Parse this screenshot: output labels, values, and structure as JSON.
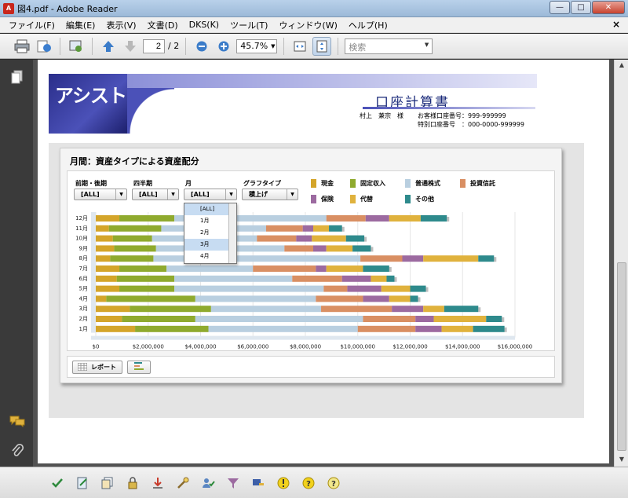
{
  "window": {
    "title": "図4.pdf - Adobe Reader"
  },
  "menu": {
    "items": [
      "ファイル(F)",
      "編集(E)",
      "表示(V)",
      "文書(D)",
      "DKS(K)",
      "ツール(T)",
      "ウィンドウ(W)",
      "ヘルプ(H)"
    ]
  },
  "toolbar": {
    "page_current": "2",
    "page_total": "/ 2",
    "zoom": "45.7%",
    "search_placeholder": "検索"
  },
  "document": {
    "logo_text": "アシスト",
    "title": "口座計算書",
    "client_name": "村上　兼宗　様",
    "account_label": "お客様口座番号：999-999999",
    "special_account_label": "特別口座番号　：000-0000-999999"
  },
  "panel": {
    "title": "月間：資産タイプによる資産配分",
    "filters": [
      {
        "label": "前期・後期",
        "value": "[ALL]"
      },
      {
        "label": "四半期",
        "value": "[ALL]"
      },
      {
        "label": "月",
        "value": "[ALL]"
      },
      {
        "label": "グラフタイプ",
        "value": "積上げ"
      }
    ],
    "dropdown_options": [
      "[ALL]",
      "1月",
      "2月",
      "3月",
      "4月"
    ],
    "report_button": "レポート"
  },
  "chart_data": {
    "type": "bar",
    "orientation": "horizontal",
    "stacked": true,
    "categories": [
      "12月",
      "11月",
      "10月",
      "9月",
      "8月",
      "7月",
      "6月",
      "5月",
      "4月",
      "3月",
      "2月",
      "1月"
    ],
    "series": [
      {
        "name": "現金",
        "color": "#d4a52a",
        "values": [
          900000,
          500000,
          650000,
          700000,
          550000,
          900000,
          800000,
          900000,
          400000,
          1300000,
          1000000,
          1500000
        ]
      },
      {
        "name": "固定収入",
        "color": "#8faa2e",
        "values": [
          2100000,
          2000000,
          1500000,
          1600000,
          1650000,
          1800000,
          2200000,
          2100000,
          3400000,
          3100000,
          2800000,
          2800000
        ]
      },
      {
        "name": "普通株式",
        "color": "#b9cfe0",
        "values": [
          5800000,
          4000000,
          4000000,
          4900000,
          7900000,
          3300000,
          4500000,
          5700000,
          4600000,
          4200000,
          6400000,
          5700000
        ]
      },
      {
        "name": "投資信託",
        "color": "#d98f63",
        "values": [
          1500000,
          1400000,
          1500000,
          1100000,
          1600000,
          2400000,
          1900000,
          900000,
          1800000,
          2700000,
          2000000,
          2200000
        ]
      },
      {
        "name": "保険",
        "color": "#9c6aa0",
        "values": [
          900000,
          400000,
          600000,
          500000,
          800000,
          400000,
          1100000,
          1300000,
          1000000,
          1200000,
          700000,
          1000000
        ]
      },
      {
        "name": "代替",
        "color": "#e0b23d",
        "values": [
          1200000,
          600000,
          1300000,
          1000000,
          2100000,
          1400000,
          600000,
          1100000,
          800000,
          800000,
          2000000,
          1200000
        ]
      },
      {
        "name": "その他",
        "color": "#2e8a8c",
        "values": [
          1000000,
          500000,
          700000,
          700000,
          600000,
          1000000,
          300000,
          600000,
          300000,
          1300000,
          600000,
          1200000
        ]
      }
    ],
    "xlim": [
      0,
      16000000
    ],
    "xticks": [
      "$0",
      "$2,000,000",
      "$4,000,000",
      "$6,000,000",
      "$8,000,000",
      "$10,000,000",
      "$12,000,000",
      "$14,000,000",
      "$16,000,000"
    ],
    "grid": true,
    "legend_position": "top-right"
  }
}
